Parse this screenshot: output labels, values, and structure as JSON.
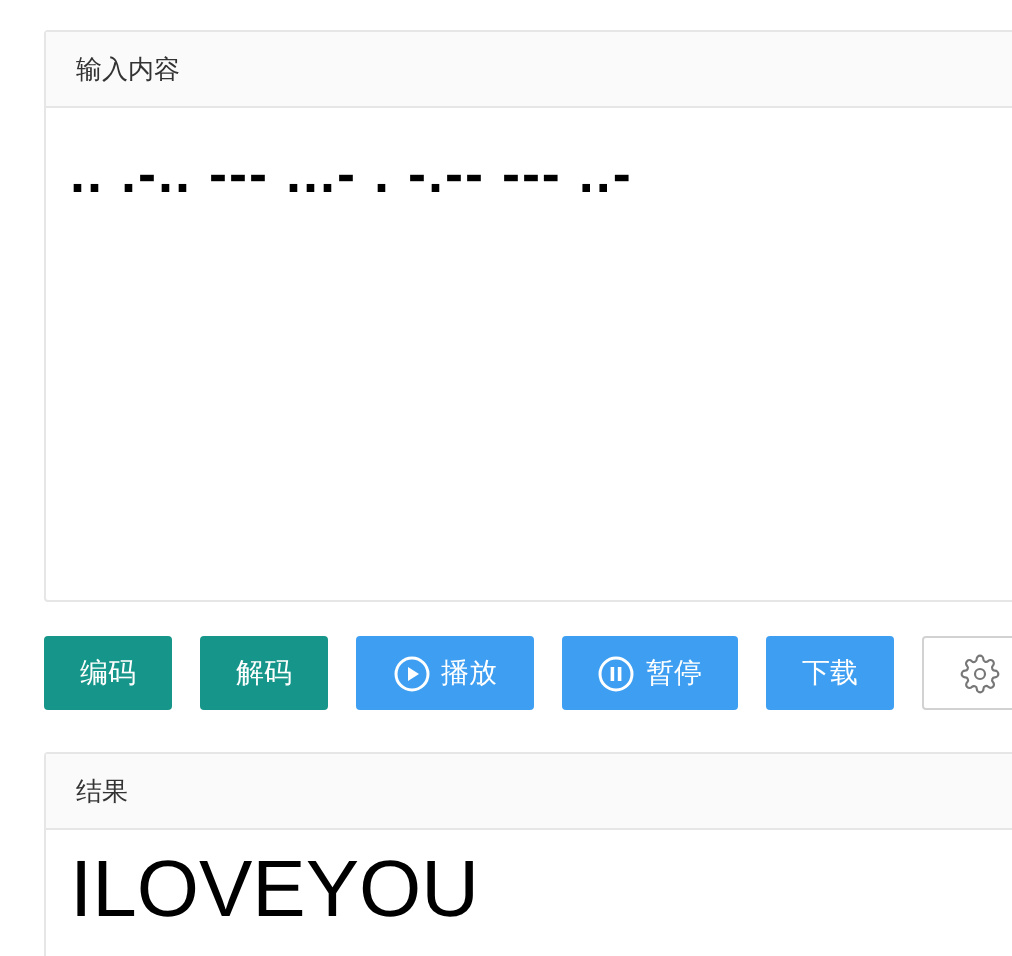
{
  "input_panel": {
    "title": "输入内容",
    "value": ".. .-.. --- ...- . -.-- --- ..-"
  },
  "buttons": [
    {
      "kind": "encode",
      "label": "编码"
    },
    {
      "kind": "decode",
      "label": "解码"
    },
    {
      "kind": "play",
      "label": "播放"
    },
    {
      "kind": "pause",
      "label": "暂停"
    },
    {
      "kind": "download",
      "label": "下载"
    },
    {
      "kind": "settings"
    }
  ],
  "result_panel": {
    "title": "结果",
    "value": "ILOVEYOU"
  }
}
